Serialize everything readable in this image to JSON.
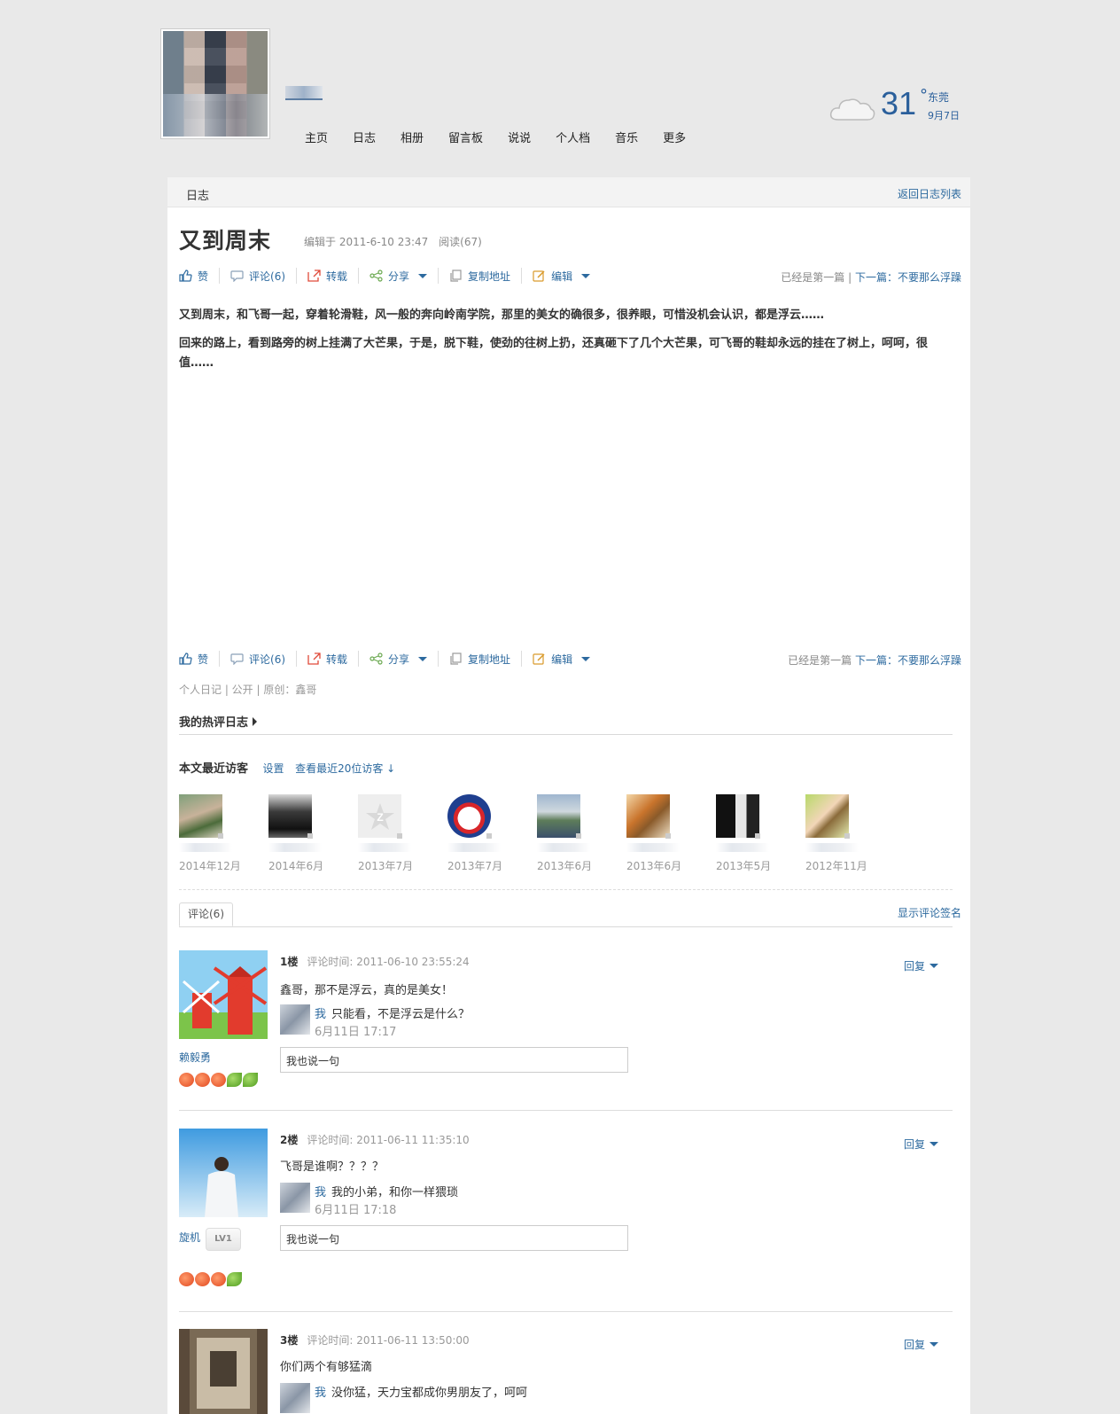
{
  "header": {
    "nav": [
      "主页",
      "日志",
      "相册",
      "留言板",
      "说说",
      "个人档",
      "音乐",
      "更多"
    ],
    "weather": {
      "temp": "31",
      "degree": "°",
      "city": "东莞",
      "date": "9月7日"
    }
  },
  "panel": {
    "title": "日志",
    "back_link": "返回日志列表"
  },
  "post": {
    "title": "又到周末",
    "edited": "编辑于 2011-6-10 23:47",
    "reads": "阅读(67)",
    "paragraphs": [
      "又到周末，和飞哥一起，穿着轮滑鞋，风一般的奔向岭南学院，那里的美女的确很多，很养眼，可惜没机会认识，都是浮云……",
      "回来的路上，看到路旁的树上挂满了大芒果，于是，脱下鞋，使劲的往树上扔，还真砸下了几个大芒果，可飞哥的鞋却永远的挂在了树上，呵呵，很值……"
    ],
    "category": "个人日记 | 公开 | 原创：鑫哥"
  },
  "toolbar": {
    "like": "赞",
    "comment": "评论(6)",
    "repost": "转载",
    "share": "分享",
    "copy": "复制地址",
    "edit": "编辑",
    "first": "已经是第一篇",
    "sep": " | ",
    "next_label": "下一篇：",
    "next_title": "不要那么浮躁"
  },
  "hot": "我的热评日志",
  "visitors": {
    "heading": "本文最近访客",
    "settings": "设置",
    "view_recent": "查看最近20位访客 ↓",
    "dates": [
      "2014年12月",
      "2014年6月",
      "2013年7月",
      "2013年7月",
      "2013年6月",
      "2013年6月",
      "2013年5月",
      "2012年11月"
    ]
  },
  "comments_tab": "评论(6)",
  "show_signature": "显示评论签名",
  "comments": [
    {
      "floor": "1楼",
      "time": "评论时间: 2011-06-10 23:55:24",
      "user": "赖毅勇",
      "text": "鑫哥，那不是浮云，真的是美女！",
      "reply_user": "我",
      "reply_text": "只能看，不是浮云是什么？",
      "reply_time": "6月11日 17:17",
      "input_placeholder": "我也说一句",
      "reply_btn": "回复"
    },
    {
      "floor": "2楼",
      "time": "评论时间: 2011-06-11 11:35:10",
      "user": "旋机",
      "level": "LV1",
      "text": "飞哥是谁啊？？？？",
      "reply_user": "我",
      "reply_text": "我的小弟，和你一样猥琐",
      "reply_time": "6月11日 17:18",
      "input_placeholder": "我也说一句",
      "reply_btn": "回复"
    },
    {
      "floor": "3楼",
      "time": "评论时间: 2011-06-11 13:50:00",
      "text": "你们两个有够猛滴",
      "reply_user": "我",
      "reply_text": "没你猛，天力宝都成你男朋友了，呵呵",
      "reply_btn": "回复"
    }
  ],
  "colors": {
    "link": "#2d6a9f",
    "weather": "#2a5f9b",
    "background": "#e9e9e9"
  }
}
